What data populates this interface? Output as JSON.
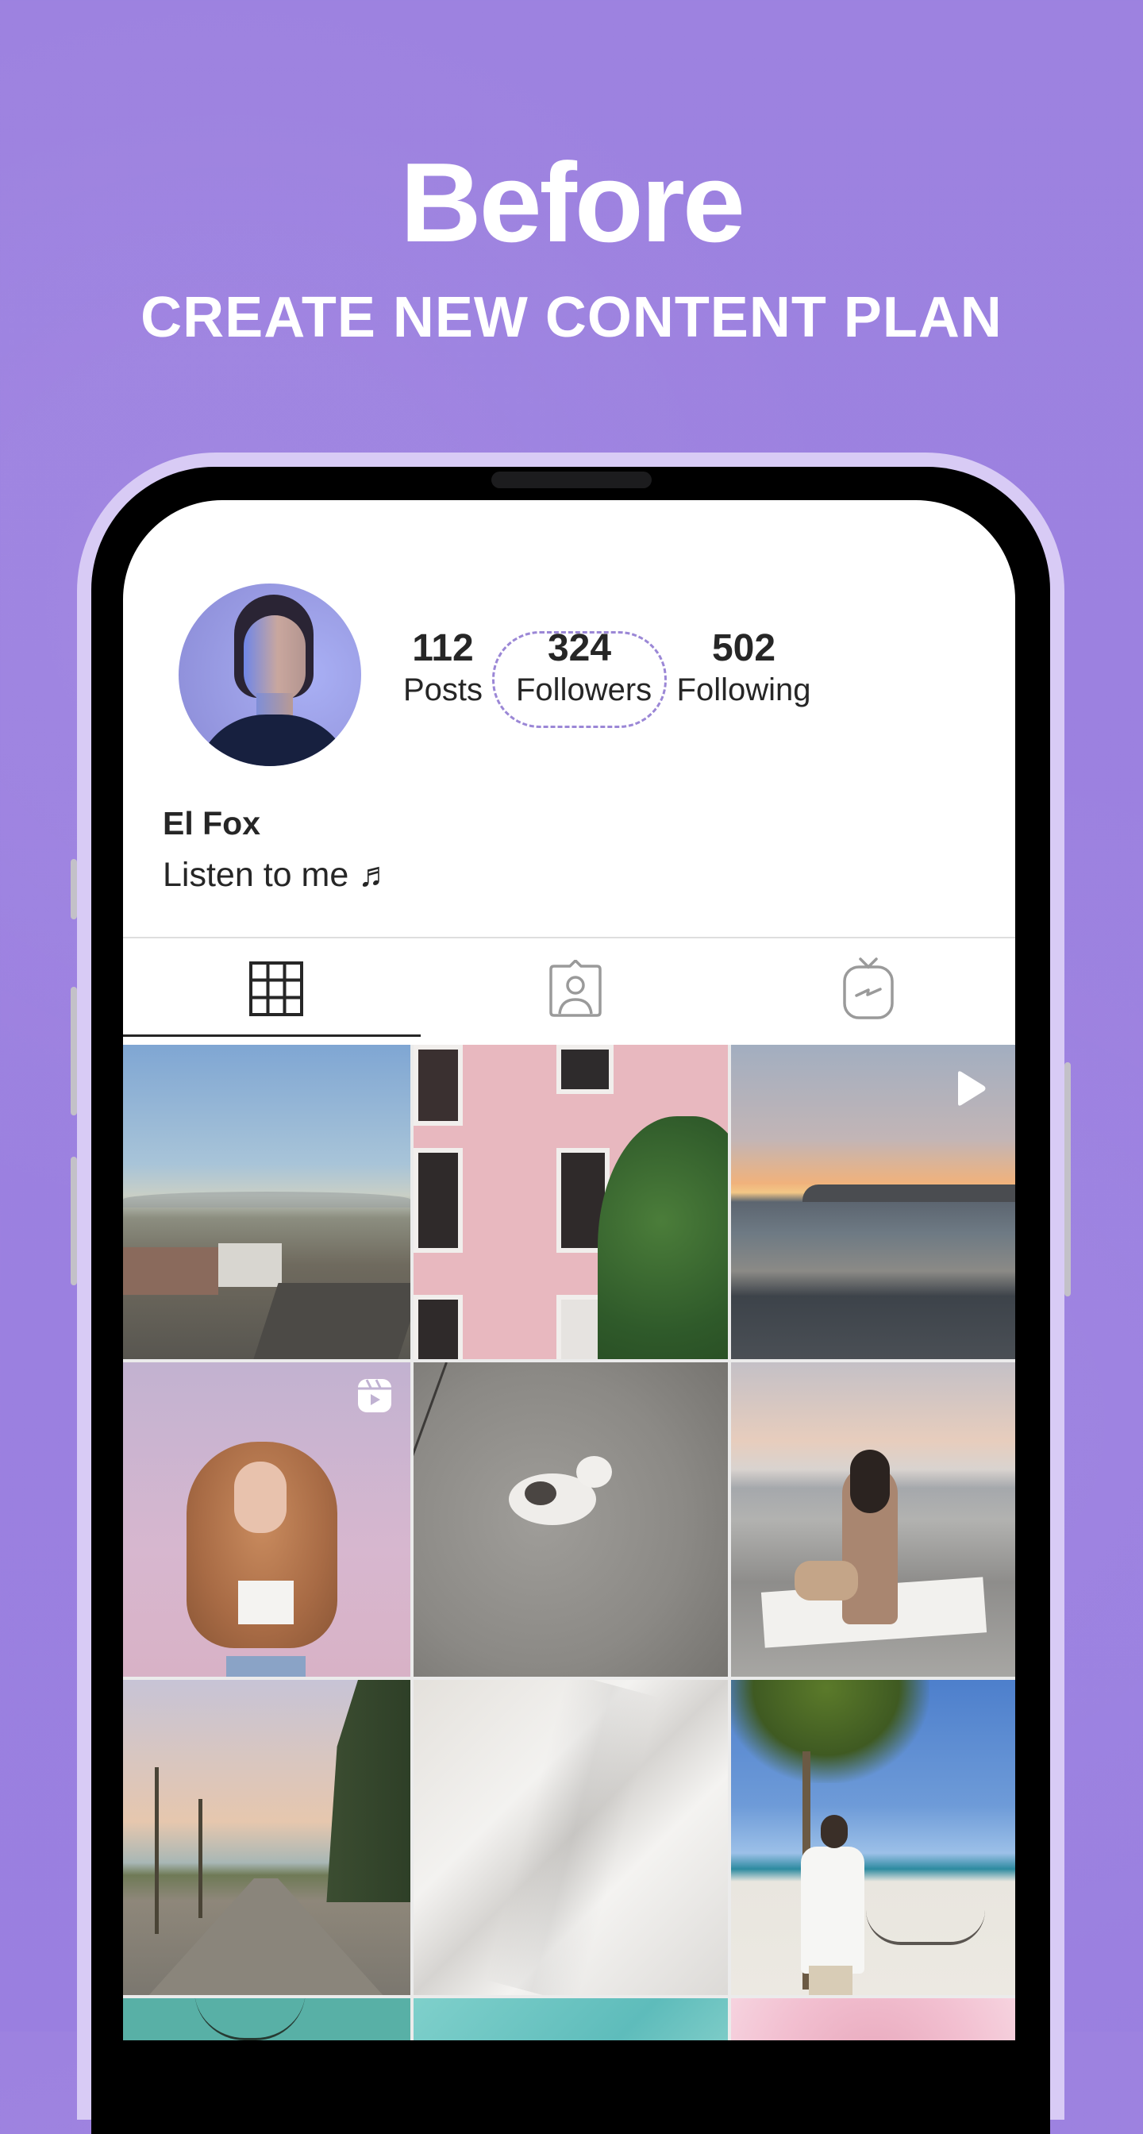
{
  "hero": {
    "title": "Before",
    "subtitle": "CREATE NEW CONTENT PLAN"
  },
  "profile": {
    "avatar_icon": "profile-photo",
    "name": "El Fox",
    "bio": "Listen to me ♬",
    "stats": [
      {
        "value": "112",
        "label": "Posts"
      },
      {
        "value": "324",
        "label": "Followers",
        "highlighted": true
      },
      {
        "value": "502",
        "label": "Following"
      }
    ]
  },
  "tabs": [
    {
      "icon": "grid-icon",
      "active": true
    },
    {
      "icon": "tagged-person-icon",
      "active": false
    },
    {
      "icon": "igtv-icon",
      "active": false
    }
  ],
  "colors": {
    "background": "#9c80df",
    "phone_frame": "#d8cbf5",
    "highlight_ring": "#9b87d6",
    "text": "#262626",
    "inactive_icon": "#9a9a9a"
  },
  "grid": {
    "posts": [
      {
        "subject": "city-rooftops-at-dusk",
        "badge": null
      },
      {
        "subject": "pink-building-facade",
        "badge": null
      },
      {
        "subject": "beach-sunset",
        "badge": "play-icon"
      },
      {
        "subject": "woman-with-curly-hair",
        "badge": "reels-icon"
      },
      {
        "subject": "white-cat-on-concrete",
        "badge": null
      },
      {
        "subject": "woman-and-child-on-pebble-beach",
        "badge": null
      },
      {
        "subject": "palm-tree-promenade",
        "badge": null
      },
      {
        "subject": "white-bed-sheets",
        "badge": null
      },
      {
        "subject": "man-on-tropical-beach",
        "badge": null
      },
      {
        "subject": "palm-leaves-teal-sky",
        "badge": null
      },
      {
        "subject": "teal-sky-clouds",
        "badge": null
      },
      {
        "subject": "pink-flower",
        "badge": null
      }
    ]
  }
}
